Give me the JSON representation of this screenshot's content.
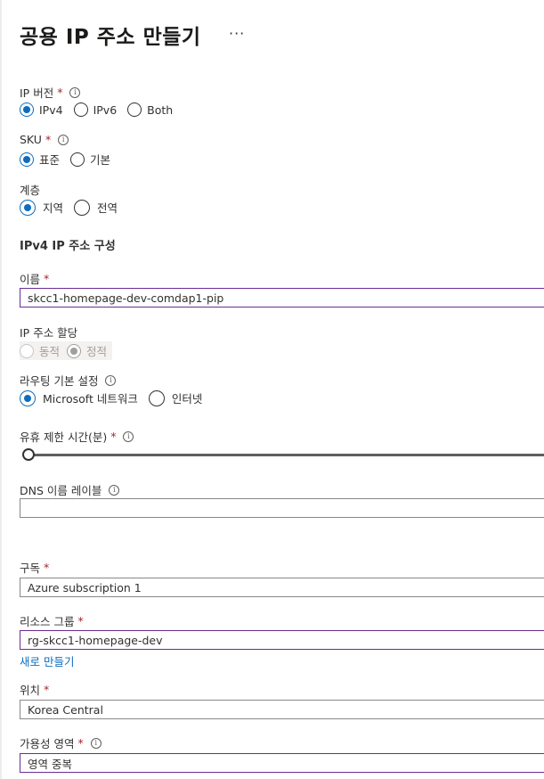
{
  "header": {
    "title": "공용 IP 주소 만들기",
    "more": "···"
  },
  "ip_version": {
    "label": "IP 버전",
    "required_mark": "*",
    "options": [
      "IPv4",
      "IPv6",
      "Both"
    ],
    "selected": "IPv4"
  },
  "sku": {
    "label": "SKU",
    "required_mark": "*",
    "options": [
      "표준",
      "기본"
    ],
    "selected": "표준"
  },
  "tier": {
    "label": "계층",
    "options": [
      "지역",
      "전역"
    ],
    "selected": "지역"
  },
  "section_title": "IPv4 IP 주소 구성",
  "name": {
    "label": "이름",
    "required_mark": "*",
    "value": "skcc1-homepage-dev-comdap1-pip"
  },
  "assignment": {
    "label": "IP 주소 할당",
    "options": [
      "동적",
      "정적"
    ],
    "selected": "정적",
    "disabled": true
  },
  "routing": {
    "label": "라우팅 기본 설정",
    "options": [
      "Microsoft 네트워크",
      "인터넷"
    ],
    "selected": "Microsoft 네트워크"
  },
  "idle_timeout": {
    "label": "유휴 제한 시간(분)",
    "required_mark": "*"
  },
  "dns": {
    "label": "DNS 이름 레이블",
    "value": ""
  },
  "subscription": {
    "label": "구독",
    "required_mark": "*",
    "value": "Azure subscription 1"
  },
  "resource_group": {
    "label": "리소스 그룹",
    "required_mark": "*",
    "value": "rg-skcc1-homepage-dev",
    "create_new": "새로 만들기"
  },
  "location": {
    "label": "위치",
    "required_mark": "*",
    "value": "Korea Central"
  },
  "zone": {
    "label": "가용성 영역",
    "required_mark": "*",
    "value": "영역 중복"
  },
  "icons": {
    "info": "info-icon",
    "more": "ellipsis-icon"
  },
  "colors": {
    "accent": "#0f6cbd",
    "required": "#a4262c",
    "focus_border": "#6b2c91"
  }
}
